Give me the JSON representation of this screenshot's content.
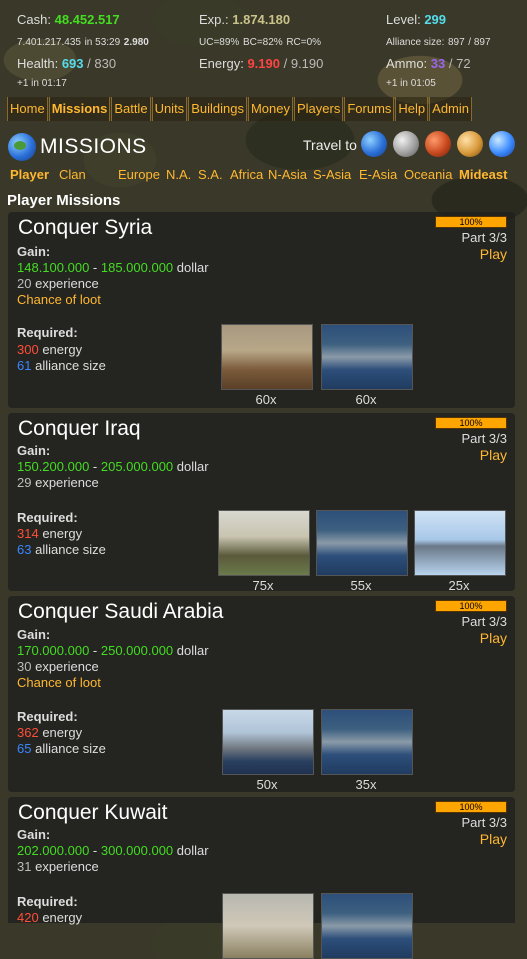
{
  "stats": {
    "cash_label": "Cash:",
    "cash_value": "48.452.517",
    "cash_bank": "7.401.217.435",
    "cash_in": "in 53:29",
    "cash_income": "2.980",
    "exp_label": "Exp.:",
    "exp_value": "1.874.180",
    "exp_uc": "UC=89%",
    "exp_bc": "BC=82%",
    "exp_rc": "RC=0%",
    "level_label": "Level:",
    "level_value": "299",
    "alliance_label": "Alliance size:",
    "alliance_value": "897",
    "alliance_max": "/ 897",
    "health_label": "Health:",
    "health_value": "693",
    "health_max": "/ 830",
    "health_regen": "+1 in 01:17",
    "energy_label": "Energy:",
    "energy_value": "9.190",
    "energy_max": "/ 9.190",
    "ammo_label": "Ammo:",
    "ammo_value": "33",
    "ammo_max": "/ 72",
    "ammo_regen": "+1 in 01:05"
  },
  "nav": [
    "Home",
    "Missions",
    "Battle",
    "Units",
    "Buildings",
    "Money",
    "Players",
    "Forums",
    "Help",
    "Admin"
  ],
  "header": {
    "title": "MISSIONS",
    "travel_label": "Travel to"
  },
  "tabs": {
    "player": "Player",
    "clan": "Clan",
    "regions": [
      "Europe",
      "N.A.",
      "S.A.",
      "Africa",
      "N-Asia",
      "S-Asia",
      "E-Asia",
      "Oceania",
      "Mideast"
    ]
  },
  "section_title": "Player Missions",
  "missions": [
    {
      "title": "Conquer Syria",
      "progress": "100%",
      "part": "Part 3/3",
      "play": "Play",
      "gain_label": "Gain:",
      "dollar_min": "148.100.000",
      "dollar_max": "185.000.000",
      "dollar_unit": "dollar",
      "exp": "20",
      "exp_unit": "experience",
      "loot": "Chance of loot",
      "req_label": "Required:",
      "energy": "300",
      "energy_unit": "energy",
      "alliance": "61",
      "alliance_unit": "alliance size",
      "units": [
        {
          "icon": "howitzer-image",
          "count": "60x"
        },
        {
          "icon": "warship-image",
          "count": "60x"
        }
      ]
    },
    {
      "title": "Conquer Iraq",
      "progress": "100%",
      "part": "Part 3/3",
      "play": "Play",
      "gain_label": "Gain:",
      "dollar_min": "150.200.000",
      "dollar_max": "205.000.000",
      "dollar_unit": "dollar",
      "exp": "29",
      "exp_unit": "experience",
      "req_label": "Required:",
      "energy": "314",
      "energy_unit": "energy",
      "alliance": "63",
      "alliance_unit": "alliance size",
      "units": [
        {
          "icon": "tank-image",
          "count": "75x"
        },
        {
          "icon": "warship-image",
          "count": "55x"
        },
        {
          "icon": "bomber-image",
          "count": "25x"
        }
      ]
    },
    {
      "title": "Conquer Saudi Arabia",
      "progress": "100%",
      "part": "Part 3/3",
      "play": "Play",
      "gain_label": "Gain:",
      "dollar_min": "170.000.000",
      "dollar_max": "250.000.000",
      "dollar_unit": "dollar",
      "exp": "30",
      "exp_unit": "experience",
      "loot": "Chance of loot",
      "req_label": "Required:",
      "energy": "362",
      "energy_unit": "energy",
      "alliance": "65",
      "alliance_unit": "alliance size",
      "units": [
        {
          "icon": "carrier-image",
          "count": "50x"
        },
        {
          "icon": "warship-image",
          "count": "35x"
        }
      ]
    },
    {
      "title": "Conquer Kuwait",
      "progress": "100%",
      "part": "Part 3/3",
      "play": "Play",
      "gain_label": "Gain:",
      "dollar_min": "202.000.000",
      "dollar_max": "300.000.000",
      "dollar_unit": "dollar",
      "exp": "31",
      "exp_unit": "experience",
      "req_label": "Required:",
      "energy": "420",
      "energy_unit": "energy"
    }
  ]
}
